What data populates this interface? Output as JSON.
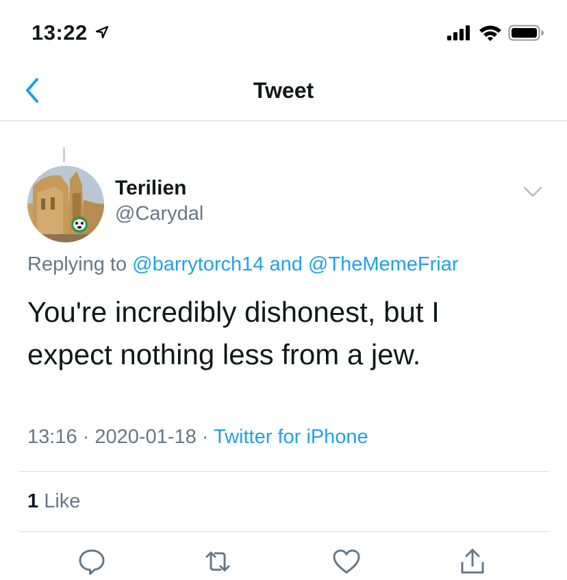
{
  "status_bar": {
    "time": "13:22",
    "icons": [
      "location-arrow-icon",
      "cellular-signal-icon",
      "wifi-icon",
      "battery-icon"
    ]
  },
  "nav": {
    "title": "Tweet",
    "back_icon": "chevron-left-icon"
  },
  "tweet": {
    "author": {
      "display_name": "Terilien",
      "handle": "@Carydal"
    },
    "replying_prefix": "Replying to",
    "reply_to": [
      "@barrytorch14",
      "@TheMemeFriar"
    ],
    "reply_joiner": "and",
    "text_line1": "You're incredibly dishonest, but I",
    "text_line2": "expect nothing less from a jew.",
    "time": "13:16",
    "date": "2020-01-18",
    "separator": "·",
    "source": "Twitter for iPhone",
    "like_count": "1",
    "like_label": "Like"
  },
  "actions": [
    "reply-icon",
    "retweet-icon",
    "like-icon",
    "share-icon"
  ],
  "colors": {
    "accent": "#1da1f2",
    "secondary_text": "#657786",
    "primary_text": "#14171a",
    "divider": "#d6dbdf"
  }
}
